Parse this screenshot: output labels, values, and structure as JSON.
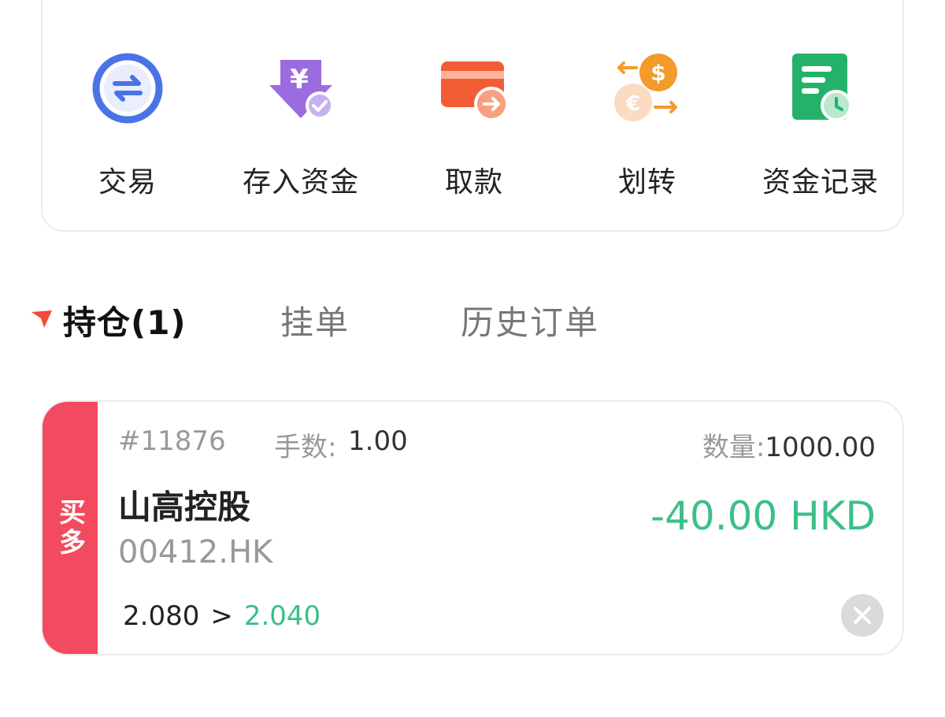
{
  "actions": [
    {
      "label": "交易",
      "icon": "exchange-icon"
    },
    {
      "label": "存入资金",
      "icon": "deposit-icon"
    },
    {
      "label": "取款",
      "icon": "withdraw-icon"
    },
    {
      "label": "划转",
      "icon": "transfer-icon"
    },
    {
      "label": "资金记录",
      "icon": "fund-record-icon"
    }
  ],
  "tabs": [
    {
      "label": "持仓(1)",
      "active": true
    },
    {
      "label": "挂单",
      "active": false
    },
    {
      "label": "历史订单",
      "active": false
    }
  ],
  "position": {
    "side": "买多",
    "order_id": "#11876",
    "lots_label": "手数:",
    "lots_value": "1.00",
    "qty_label": "数量:",
    "qty_value": "1000.00",
    "name": "山高控股",
    "code": "00412.HK",
    "pnl": "-40.00 HKD",
    "open_price": "2.080",
    "separator": ">",
    "current_price": "2.040"
  },
  "colors": {
    "buy_tag": "#f24a5e",
    "pnl_green": "#3cbf86",
    "accent_blue": "#4a73e8"
  }
}
